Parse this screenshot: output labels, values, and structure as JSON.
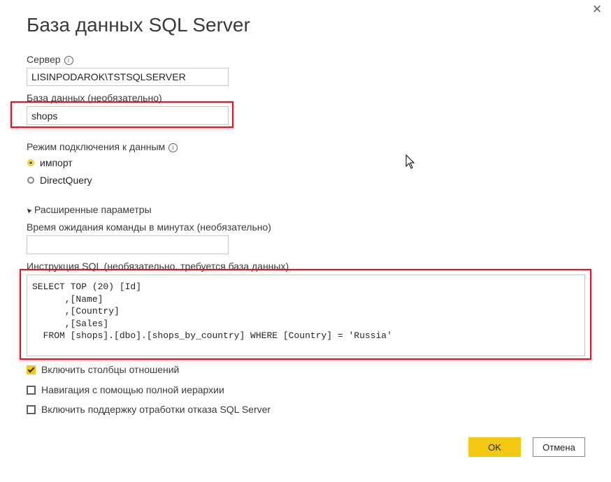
{
  "dialog": {
    "title": "База данных SQL Server",
    "close_glyph": "×"
  },
  "server": {
    "label": "Сервер",
    "value": "LISINPODAROK\\TSTSQLSERVER"
  },
  "database": {
    "label": "База данных (необязательно)",
    "value": "shops"
  },
  "connection_mode": {
    "label": "Режим подключения к данным",
    "options": [
      {
        "label": "импорт",
        "selected": true
      },
      {
        "label": "DirectQuery",
        "selected": false
      }
    ]
  },
  "advanced": {
    "toggle_label": "Расширенные параметры",
    "timeout_label": "Время ожидания команды в минутах (необязательно)",
    "timeout_value": "",
    "sql_label": "Инструкция SQL (необязательно, требуется база данных)",
    "sql_text": "SELECT TOP (20) [Id]\n      ,[Name]\n      ,[Country]\n      ,[Sales]\n  FROM [shops].[dbo].[shops_by_country] WHERE [Country] = 'Russia'",
    "checkboxes": [
      {
        "label": "Включить столбцы отношений",
        "checked": true
      },
      {
        "label": "Навигация с помощью полной иерархии",
        "checked": false
      },
      {
        "label": "Включить поддержку отработки отказа SQL Server",
        "checked": false
      }
    ]
  },
  "buttons": {
    "ok": "OK",
    "cancel": "Отмена"
  },
  "icons": {
    "info": "info-icon",
    "close": "close-icon",
    "cursor": "mouse-pointer-icon"
  },
  "colors": {
    "accent": "#f2c811",
    "highlight": "#e81123"
  }
}
